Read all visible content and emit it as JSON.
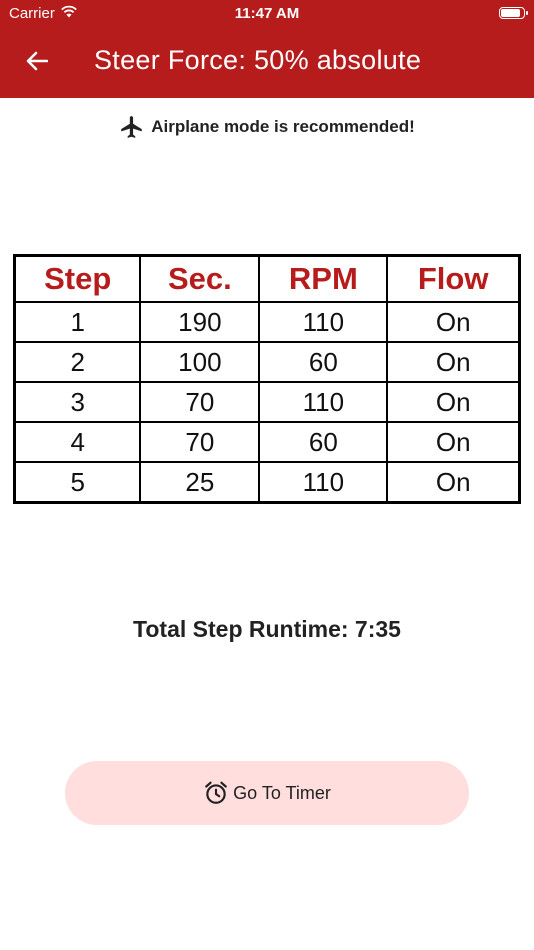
{
  "status_bar": {
    "carrier": "Carrier",
    "time": "11:47 AM"
  },
  "header": {
    "title": "Steer Force: 50% absolute"
  },
  "notice": {
    "text": "Airplane mode is recommended!"
  },
  "table": {
    "headers": [
      "Step",
      "Sec.",
      "RPM",
      "Flow"
    ],
    "rows": [
      [
        "1",
        "190",
        "110",
        "On"
      ],
      [
        "2",
        "100",
        "60",
        "On"
      ],
      [
        "3",
        "70",
        "110",
        "On"
      ],
      [
        "4",
        "70",
        "60",
        "On"
      ],
      [
        "5",
        "25",
        "110",
        "On"
      ]
    ]
  },
  "runtime": {
    "text": "Total Step Runtime: 7:35"
  },
  "timer_button": {
    "label": "Go To Timer"
  },
  "colors": {
    "primary": "#b71c1c",
    "button_bg": "#ffdedd"
  }
}
